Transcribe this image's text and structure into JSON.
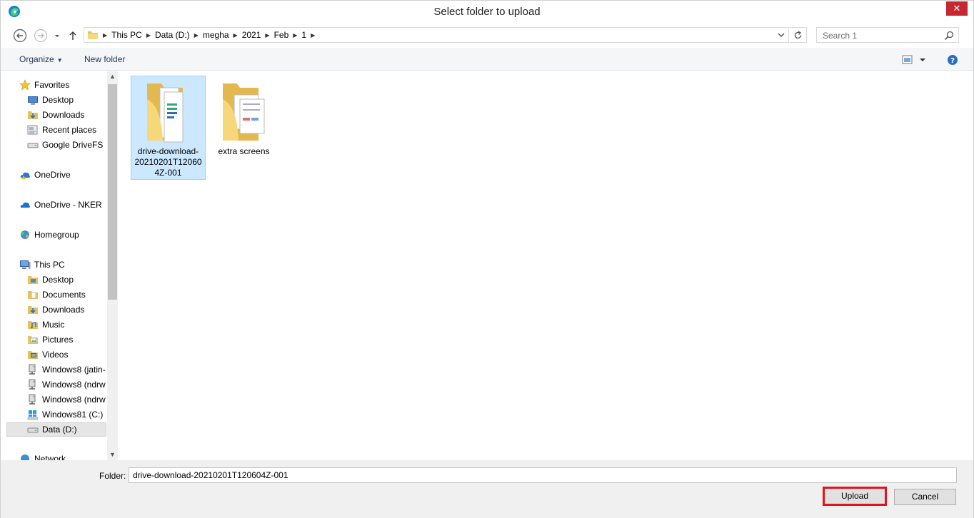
{
  "window": {
    "title": "Select folder to upload"
  },
  "address": {
    "breadcrumbs": [
      "This PC",
      "Data (D:)",
      "megha",
      "2021",
      "Feb",
      "1"
    ],
    "search_placeholder": "Search 1"
  },
  "toolbar": {
    "organize_label": "Organize",
    "new_folder_label": "New folder"
  },
  "nav": {
    "favorites": {
      "label": "Favorites",
      "items": [
        "Desktop",
        "Downloads",
        "Recent places",
        "Google DriveFS"
      ]
    },
    "onedrive": "OneDrive",
    "onedrive_nker": "OneDrive - NKER",
    "homegroup": "Homegroup",
    "this_pc": {
      "label": "This PC",
      "items": [
        "Desktop",
        "Documents",
        "Downloads",
        "Music",
        "Pictures",
        "Videos",
        "Windows8 (jatin-",
        "Windows8 (ndrw",
        "Windows8 (ndrw",
        "Windows81 (C:)",
        "Data (D:)"
      ]
    },
    "network": "Network",
    "selected": "Data (D:)"
  },
  "folders": [
    {
      "name": "drive-download-20210201T120604Z-001",
      "selected": true
    },
    {
      "name": "extra screens",
      "selected": false
    }
  ],
  "footer": {
    "folder_label": "Folder:",
    "folder_value": "drive-download-20210201T120604Z-001",
    "upload_label": "Upload",
    "cancel_label": "Cancel"
  },
  "colors": {
    "accent": "#1e395b",
    "selection": "#cce8ff",
    "close": "#c7282f",
    "highlight": "#e3131e"
  }
}
